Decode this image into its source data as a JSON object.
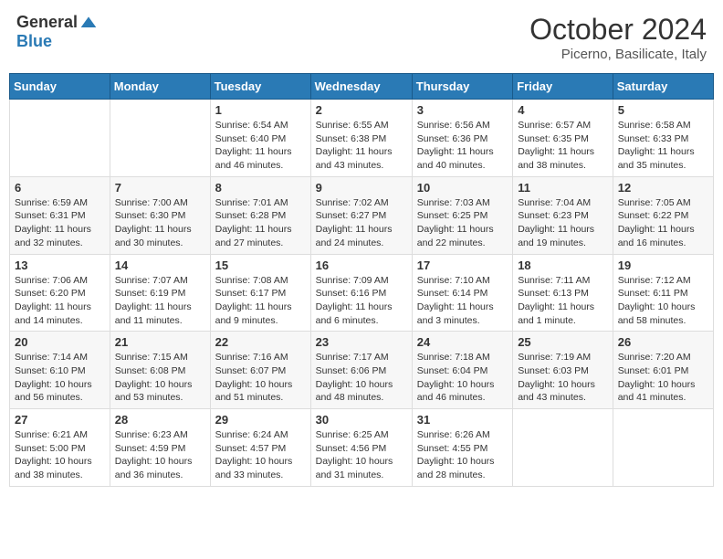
{
  "header": {
    "logo_general": "General",
    "logo_blue": "Blue",
    "month_year": "October 2024",
    "location": "Picerno, Basilicate, Italy"
  },
  "weekdays": [
    "Sunday",
    "Monday",
    "Tuesday",
    "Wednesday",
    "Thursday",
    "Friday",
    "Saturday"
  ],
  "weeks": [
    [
      {
        "day": "",
        "sunrise": "",
        "sunset": "",
        "daylight": ""
      },
      {
        "day": "",
        "sunrise": "",
        "sunset": "",
        "daylight": ""
      },
      {
        "day": "1",
        "sunrise": "Sunrise: 6:54 AM",
        "sunset": "Sunset: 6:40 PM",
        "daylight": "Daylight: 11 hours and 46 minutes."
      },
      {
        "day": "2",
        "sunrise": "Sunrise: 6:55 AM",
        "sunset": "Sunset: 6:38 PM",
        "daylight": "Daylight: 11 hours and 43 minutes."
      },
      {
        "day": "3",
        "sunrise": "Sunrise: 6:56 AM",
        "sunset": "Sunset: 6:36 PM",
        "daylight": "Daylight: 11 hours and 40 minutes."
      },
      {
        "day": "4",
        "sunrise": "Sunrise: 6:57 AM",
        "sunset": "Sunset: 6:35 PM",
        "daylight": "Daylight: 11 hours and 38 minutes."
      },
      {
        "day": "5",
        "sunrise": "Sunrise: 6:58 AM",
        "sunset": "Sunset: 6:33 PM",
        "daylight": "Daylight: 11 hours and 35 minutes."
      }
    ],
    [
      {
        "day": "6",
        "sunrise": "Sunrise: 6:59 AM",
        "sunset": "Sunset: 6:31 PM",
        "daylight": "Daylight: 11 hours and 32 minutes."
      },
      {
        "day": "7",
        "sunrise": "Sunrise: 7:00 AM",
        "sunset": "Sunset: 6:30 PM",
        "daylight": "Daylight: 11 hours and 30 minutes."
      },
      {
        "day": "8",
        "sunrise": "Sunrise: 7:01 AM",
        "sunset": "Sunset: 6:28 PM",
        "daylight": "Daylight: 11 hours and 27 minutes."
      },
      {
        "day": "9",
        "sunrise": "Sunrise: 7:02 AM",
        "sunset": "Sunset: 6:27 PM",
        "daylight": "Daylight: 11 hours and 24 minutes."
      },
      {
        "day": "10",
        "sunrise": "Sunrise: 7:03 AM",
        "sunset": "Sunset: 6:25 PM",
        "daylight": "Daylight: 11 hours and 22 minutes."
      },
      {
        "day": "11",
        "sunrise": "Sunrise: 7:04 AM",
        "sunset": "Sunset: 6:23 PM",
        "daylight": "Daylight: 11 hours and 19 minutes."
      },
      {
        "day": "12",
        "sunrise": "Sunrise: 7:05 AM",
        "sunset": "Sunset: 6:22 PM",
        "daylight": "Daylight: 11 hours and 16 minutes."
      }
    ],
    [
      {
        "day": "13",
        "sunrise": "Sunrise: 7:06 AM",
        "sunset": "Sunset: 6:20 PM",
        "daylight": "Daylight: 11 hours and 14 minutes."
      },
      {
        "day": "14",
        "sunrise": "Sunrise: 7:07 AM",
        "sunset": "Sunset: 6:19 PM",
        "daylight": "Daylight: 11 hours and 11 minutes."
      },
      {
        "day": "15",
        "sunrise": "Sunrise: 7:08 AM",
        "sunset": "Sunset: 6:17 PM",
        "daylight": "Daylight: 11 hours and 9 minutes."
      },
      {
        "day": "16",
        "sunrise": "Sunrise: 7:09 AM",
        "sunset": "Sunset: 6:16 PM",
        "daylight": "Daylight: 11 hours and 6 minutes."
      },
      {
        "day": "17",
        "sunrise": "Sunrise: 7:10 AM",
        "sunset": "Sunset: 6:14 PM",
        "daylight": "Daylight: 11 hours and 3 minutes."
      },
      {
        "day": "18",
        "sunrise": "Sunrise: 7:11 AM",
        "sunset": "Sunset: 6:13 PM",
        "daylight": "Daylight: 11 hours and 1 minute."
      },
      {
        "day": "19",
        "sunrise": "Sunrise: 7:12 AM",
        "sunset": "Sunset: 6:11 PM",
        "daylight": "Daylight: 10 hours and 58 minutes."
      }
    ],
    [
      {
        "day": "20",
        "sunrise": "Sunrise: 7:14 AM",
        "sunset": "Sunset: 6:10 PM",
        "daylight": "Daylight: 10 hours and 56 minutes."
      },
      {
        "day": "21",
        "sunrise": "Sunrise: 7:15 AM",
        "sunset": "Sunset: 6:08 PM",
        "daylight": "Daylight: 10 hours and 53 minutes."
      },
      {
        "day": "22",
        "sunrise": "Sunrise: 7:16 AM",
        "sunset": "Sunset: 6:07 PM",
        "daylight": "Daylight: 10 hours and 51 minutes."
      },
      {
        "day": "23",
        "sunrise": "Sunrise: 7:17 AM",
        "sunset": "Sunset: 6:06 PM",
        "daylight": "Daylight: 10 hours and 48 minutes."
      },
      {
        "day": "24",
        "sunrise": "Sunrise: 7:18 AM",
        "sunset": "Sunset: 6:04 PM",
        "daylight": "Daylight: 10 hours and 46 minutes."
      },
      {
        "day": "25",
        "sunrise": "Sunrise: 7:19 AM",
        "sunset": "Sunset: 6:03 PM",
        "daylight": "Daylight: 10 hours and 43 minutes."
      },
      {
        "day": "26",
        "sunrise": "Sunrise: 7:20 AM",
        "sunset": "Sunset: 6:01 PM",
        "daylight": "Daylight: 10 hours and 41 minutes."
      }
    ],
    [
      {
        "day": "27",
        "sunrise": "Sunrise: 6:21 AM",
        "sunset": "Sunset: 5:00 PM",
        "daylight": "Daylight: 10 hours and 38 minutes."
      },
      {
        "day": "28",
        "sunrise": "Sunrise: 6:23 AM",
        "sunset": "Sunset: 4:59 PM",
        "daylight": "Daylight: 10 hours and 36 minutes."
      },
      {
        "day": "29",
        "sunrise": "Sunrise: 6:24 AM",
        "sunset": "Sunset: 4:57 PM",
        "daylight": "Daylight: 10 hours and 33 minutes."
      },
      {
        "day": "30",
        "sunrise": "Sunrise: 6:25 AM",
        "sunset": "Sunset: 4:56 PM",
        "daylight": "Daylight: 10 hours and 31 minutes."
      },
      {
        "day": "31",
        "sunrise": "Sunrise: 6:26 AM",
        "sunset": "Sunset: 4:55 PM",
        "daylight": "Daylight: 10 hours and 28 minutes."
      },
      {
        "day": "",
        "sunrise": "",
        "sunset": "",
        "daylight": ""
      },
      {
        "day": "",
        "sunrise": "",
        "sunset": "",
        "daylight": ""
      }
    ]
  ]
}
